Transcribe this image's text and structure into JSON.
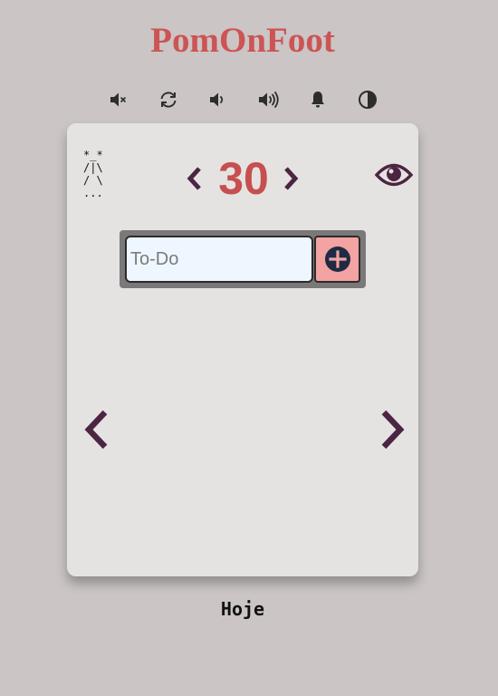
{
  "app": {
    "title": "PomOnFoot"
  },
  "toolbar": {
    "buttons": [
      {
        "icon": "mute-icon"
      },
      {
        "icon": "refresh-icon"
      },
      {
        "icon": "volume-down-icon"
      },
      {
        "icon": "volume-up-icon"
      },
      {
        "icon": "bell-icon"
      },
      {
        "icon": "contrast-icon"
      }
    ]
  },
  "card": {
    "ascii_figure": "*_*\n/|\\\n/ \\\n...",
    "timer": {
      "value": "30",
      "decrease_icon": "chevron-left-icon",
      "increase_icon": "chevron-right-icon"
    },
    "visibility_icon": "eye-icon",
    "todo": {
      "placeholder": "To-Do",
      "value": "",
      "add_icon": "plus-circle-icon"
    },
    "nav": {
      "prev_icon": "chevron-left-icon",
      "next_icon": "chevron-right-icon"
    }
  },
  "footer": {
    "day_label": "Hoje"
  },
  "colors": {
    "background": "#cbc5c5",
    "title": "#cd5454",
    "card": "#e5e3e2",
    "accent_dark": "#4b2541",
    "timer": "#c74f4f",
    "add_button": "#f2a3a2",
    "input_bg": "#eef6ff"
  }
}
